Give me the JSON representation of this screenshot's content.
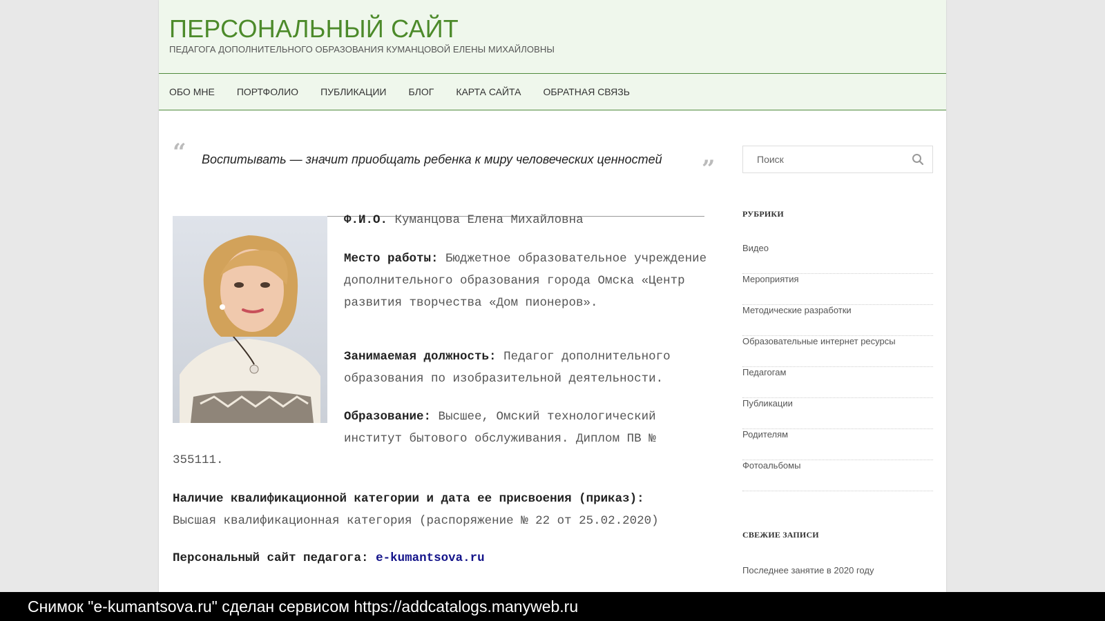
{
  "header": {
    "title": "ПЕРСОНАЛЬНЫЙ САЙТ",
    "subtitle": "ПЕДАГОГА ДОПОЛНИТЕЛЬНОГО ОБРАЗОВАНИЯ КУМАНЦОВОЙ ЕЛЕНЫ МИХАЙЛОВНЫ"
  },
  "nav": {
    "items": [
      "ОБО МНЕ",
      "ПОРТФОЛИО",
      "ПУБЛИКАЦИИ",
      "БЛОГ",
      "КАРТА САЙТА",
      "ОБРАТНАЯ СВЯЗЬ"
    ]
  },
  "quote": {
    "open": "“",
    "close": "”",
    "text": "Воспитывать — значит приобщать ребенка к миру человеческих ценностей"
  },
  "profile": {
    "fio_label": "Ф.И.О.",
    "fio_value": "Куманцова Елена Михайловна",
    "work_label": "Место работы:",
    "work_value": "Бюджетное образовательное учреждение дополнительного образования города Омска «Центр развития творчества «Дом пионеров».",
    "position_label": "Занимаемая должность:",
    "position_value": "Педагог дополнительного образования по изобразительной деятельности.",
    "edu_label": "Образование:",
    "edu_value": "Высшее, Омский технологический институт бытового обслуживания. Диплом ПВ №",
    "edu_value_cont": "355111.",
    "qual_label": "Наличие квалификационной категории и дата ее присвоения (приказ):",
    "qual_value": "Высшая квалификационная категория (распоряжение № 22 от 25.02.2020)",
    "site_label": "Персональный сайт педагога:",
    "site_link": "e-kumantsova.ru"
  },
  "sidebar": {
    "search_placeholder": "Поиск",
    "categories_title": "РУБРИКИ",
    "categories": [
      "Видео",
      "Мероприятия",
      "Методические разработки",
      "Образовательные интернет ресурсы",
      "Педагогам",
      "Публикации",
      "Родителям",
      "Фотоальбомы"
    ],
    "recent_title": "СВЕЖИЕ ЗАПИСИ",
    "recent": [
      "Последнее занятие в 2020 году"
    ]
  },
  "footer": {
    "caption": "Снимок \"e-kumantsova.ru\" сделан сервисом https://addcatalogs.manyweb.ru"
  },
  "colors": {
    "title_green": "#4c8a2a",
    "header_bg": "#eff7ec",
    "link_blue": "#14148a"
  }
}
